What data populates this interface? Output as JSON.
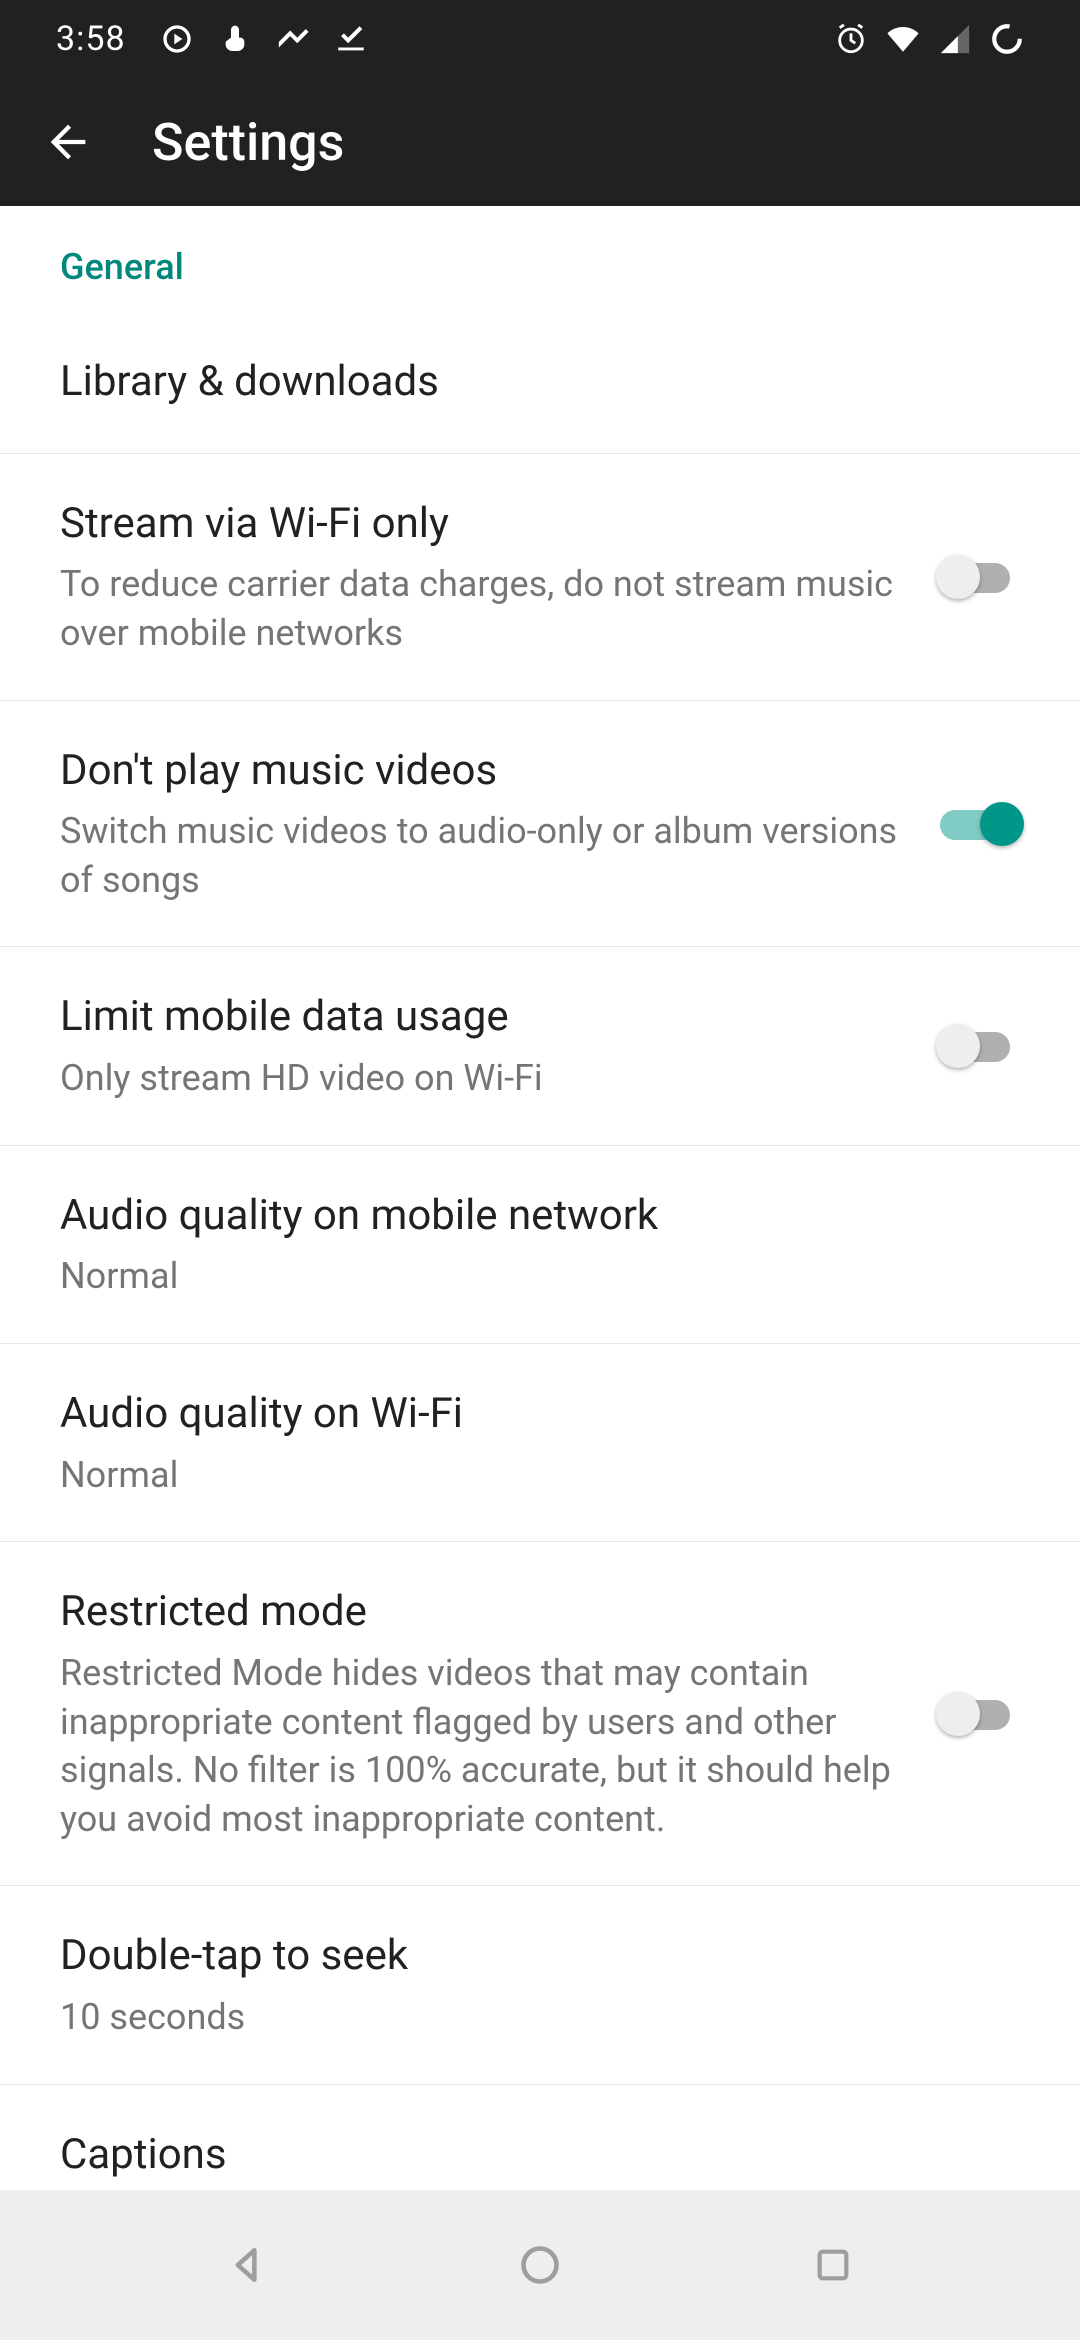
{
  "status": {
    "time": "3:58"
  },
  "app_bar": {
    "title": "Settings"
  },
  "section": {
    "header": "General"
  },
  "items": [
    {
      "title": "Library & downloads",
      "subtitle": null,
      "has_switch": false
    },
    {
      "title": "Stream via Wi-Fi only",
      "subtitle": "To reduce carrier data charges, do not stream music over mobile networks",
      "has_switch": true,
      "switch_on": false
    },
    {
      "title": "Don't play music videos",
      "subtitle": "Switch music videos to audio-only or album versions of songs",
      "has_switch": true,
      "switch_on": true
    },
    {
      "title": "Limit mobile data usage",
      "subtitle": "Only stream HD video on Wi-Fi",
      "has_switch": true,
      "switch_on": false
    },
    {
      "title": "Audio quality on mobile network",
      "subtitle": "Normal",
      "has_switch": false
    },
    {
      "title": "Audio quality on Wi-Fi",
      "subtitle": "Normal",
      "has_switch": false
    },
    {
      "title": "Restricted mode",
      "subtitle": "Restricted Mode hides videos that may contain inappropriate content flagged by users and other signals. No filter is 100% accurate, but it should help you avoid most inappropriate content.",
      "has_switch": true,
      "switch_on": false
    },
    {
      "title": "Double-tap to seek",
      "subtitle": "10 seconds",
      "has_switch": false
    },
    {
      "title": "Captions",
      "subtitle": null,
      "has_switch": false
    }
  ]
}
